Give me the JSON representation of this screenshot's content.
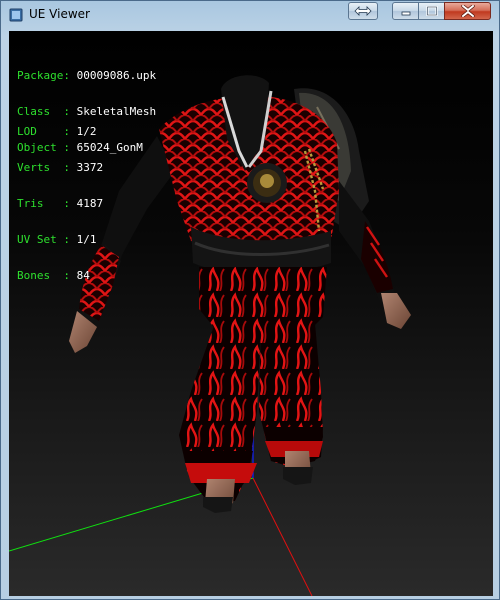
{
  "window": {
    "title": "UE Viewer",
    "buttons": {
      "fullscreen": "fullscreen-toggle",
      "minimize": "minimize",
      "maximize": "maximize",
      "close": "close"
    },
    "colors": {
      "info_label": "#2ee02e",
      "info_value": "#ffffff",
      "axis_x": "#e01010",
      "axis_y": "#10e010",
      "axis_z": "#1020ff",
      "close_button": "#c0391f"
    }
  },
  "info": {
    "package_label": "Package:",
    "package_value": "00009086.upk",
    "class_label": "Class  :",
    "class_value": "SkeletalMesh",
    "object_label": "Object :",
    "object_value": "65024_GonM",
    "lod_label": "LOD    :",
    "lod_value": "1/2",
    "verts_label": "Verts  :",
    "verts_value": "3372",
    "tris_label": "Tris   :",
    "tris_value": "4187",
    "uvset_label": "UV Set :",
    "uvset_value": "1/1",
    "bones_label": "Bones  :",
    "bones_value": "84"
  },
  "viewport": {
    "model": "armored-character-mesh",
    "axes": [
      "x-axis",
      "y-axis",
      "z-axis"
    ]
  }
}
